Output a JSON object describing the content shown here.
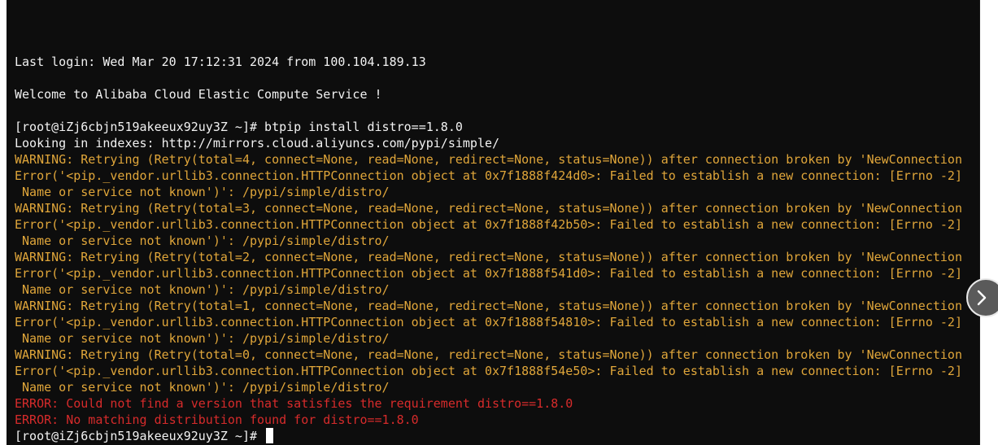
{
  "terminal": {
    "lines": [
      {
        "text": "Last login: Wed Mar 20 17:12:31 2024 from 100.104.189.13",
        "style": "white"
      },
      {
        "text": "",
        "style": "white"
      },
      {
        "text": "Welcome to Alibaba Cloud Elastic Compute Service !",
        "style": "white"
      },
      {
        "text": "",
        "style": "white"
      },
      {
        "text": "[root@iZj6cbjn519akeeux92uy3Z ~]# btpip install distro==1.8.0",
        "style": "white"
      },
      {
        "text": "Looking in indexes: http://mirrors.cloud.aliyuncs.com/pypi/simple/",
        "style": "white"
      },
      {
        "text": "WARNING: Retrying (Retry(total=4, connect=None, read=None, redirect=None, status=None)) after connection broken by 'NewConnection",
        "style": "yellow"
      },
      {
        "text": "Error('<pip._vendor.urllib3.connection.HTTPConnection object at 0x7f1888f424d0>: Failed to establish a new connection: [Errno -2]",
        "style": "yellow"
      },
      {
        "text": " Name or service not known')': /pypi/simple/distro/",
        "style": "yellow"
      },
      {
        "text": "WARNING: Retrying (Retry(total=3, connect=None, read=None, redirect=None, status=None)) after connection broken by 'NewConnection",
        "style": "yellow"
      },
      {
        "text": "Error('<pip._vendor.urllib3.connection.HTTPConnection object at 0x7f1888f42b50>: Failed to establish a new connection: [Errno -2]",
        "style": "yellow"
      },
      {
        "text": " Name or service not known')': /pypi/simple/distro/",
        "style": "yellow"
      },
      {
        "text": "WARNING: Retrying (Retry(total=2, connect=None, read=None, redirect=None, status=None)) after connection broken by 'NewConnection",
        "style": "yellow"
      },
      {
        "text": "Error('<pip._vendor.urllib3.connection.HTTPConnection object at 0x7f1888f541d0>: Failed to establish a new connection: [Errno -2]",
        "style": "yellow"
      },
      {
        "text": " Name or service not known')': /pypi/simple/distro/",
        "style": "yellow"
      },
      {
        "text": "WARNING: Retrying (Retry(total=1, connect=None, read=None, redirect=None, status=None)) after connection broken by 'NewConnection",
        "style": "yellow"
      },
      {
        "text": "Error('<pip._vendor.urllib3.connection.HTTPConnection object at 0x7f1888f54810>: Failed to establish a new connection: [Errno -2]",
        "style": "yellow"
      },
      {
        "text": " Name or service not known')': /pypi/simple/distro/",
        "style": "yellow"
      },
      {
        "text": "WARNING: Retrying (Retry(total=0, connect=None, read=None, redirect=None, status=None)) after connection broken by 'NewConnection",
        "style": "yellow"
      },
      {
        "text": "Error('<pip._vendor.urllib3.connection.HTTPConnection object at 0x7f1888f54e50>: Failed to establish a new connection: [Errno -2]",
        "style": "yellow"
      },
      {
        "text": " Name or service not known')': /pypi/simple/distro/",
        "style": "yellow"
      },
      {
        "text": "ERROR: Could not find a version that satisfies the requirement distro==1.8.0",
        "style": "red"
      },
      {
        "text": "ERROR: No matching distribution found for distro==1.8.0",
        "style": "red"
      }
    ],
    "prompt": "[root@iZj6cbjn519akeeux92uy3Z ~]# "
  },
  "colors": {
    "background": "#0d0d0d",
    "text": "#f2f2f2",
    "warning": "#e0a63a",
    "error": "#d72b2b"
  },
  "icons": {
    "side_button": "chevron-right-icon"
  }
}
